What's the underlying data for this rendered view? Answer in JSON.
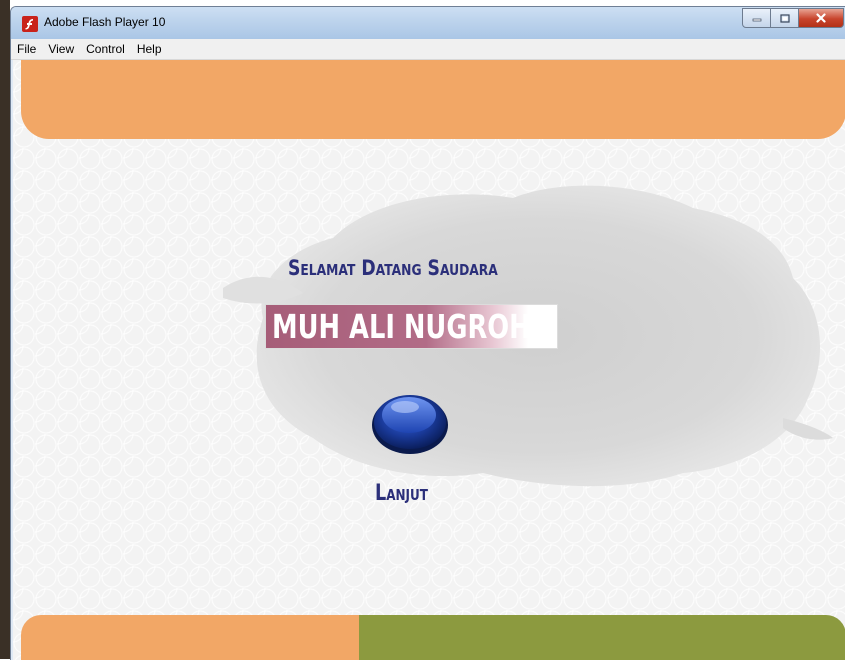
{
  "window": {
    "title": "Adobe Flash Player 10",
    "app_icon": "flash-icon",
    "controls": [
      "minimize-icon",
      "maximize-icon",
      "close-icon"
    ]
  },
  "menubar": {
    "items": [
      "File",
      "View",
      "Control",
      "Help"
    ]
  },
  "content": {
    "welcome_text": "Selamat Datang Saudara",
    "user_name": "MUH ALI NUGROHO",
    "next_label": "Lanjut",
    "next_icon": "blue-round-button-icon"
  },
  "colors": {
    "orange_band": "#f2a766",
    "green_band": "#8c9a3f",
    "text_navy": "#2b2f7a",
    "name_box": "#a65d78",
    "button_blue": "#1a3a9a"
  }
}
